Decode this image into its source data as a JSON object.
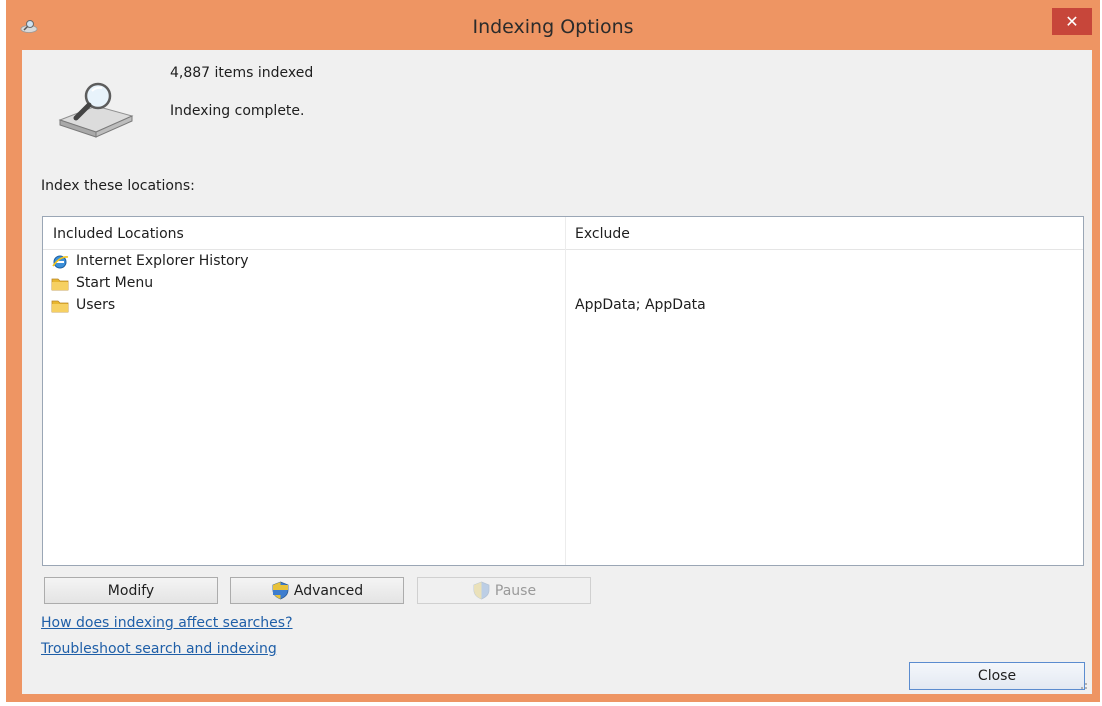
{
  "window": {
    "title": "Indexing Options",
    "close_glyph": "✕",
    "accent_color": "#ee9563",
    "close_color": "#c7463a"
  },
  "status": {
    "items_indexed": "4,887 items indexed",
    "message": "Indexing complete."
  },
  "locations": {
    "label": "Index these locations:",
    "columns": [
      "Included Locations",
      "Exclude"
    ],
    "rows": [
      {
        "icon": "internet-explorer-icon",
        "location": "Internet Explorer History",
        "exclude": ""
      },
      {
        "icon": "folder-icon",
        "location": "Start Menu",
        "exclude": ""
      },
      {
        "icon": "folder-icon",
        "location": "Users",
        "exclude": "AppData; AppData"
      }
    ]
  },
  "buttons": {
    "modify": "Modify",
    "advanced": "Advanced",
    "pause": "Pause",
    "close": "Close"
  },
  "links": {
    "affect_searches": "How does indexing affect searches?",
    "troubleshoot": "Troubleshoot search and indexing"
  }
}
